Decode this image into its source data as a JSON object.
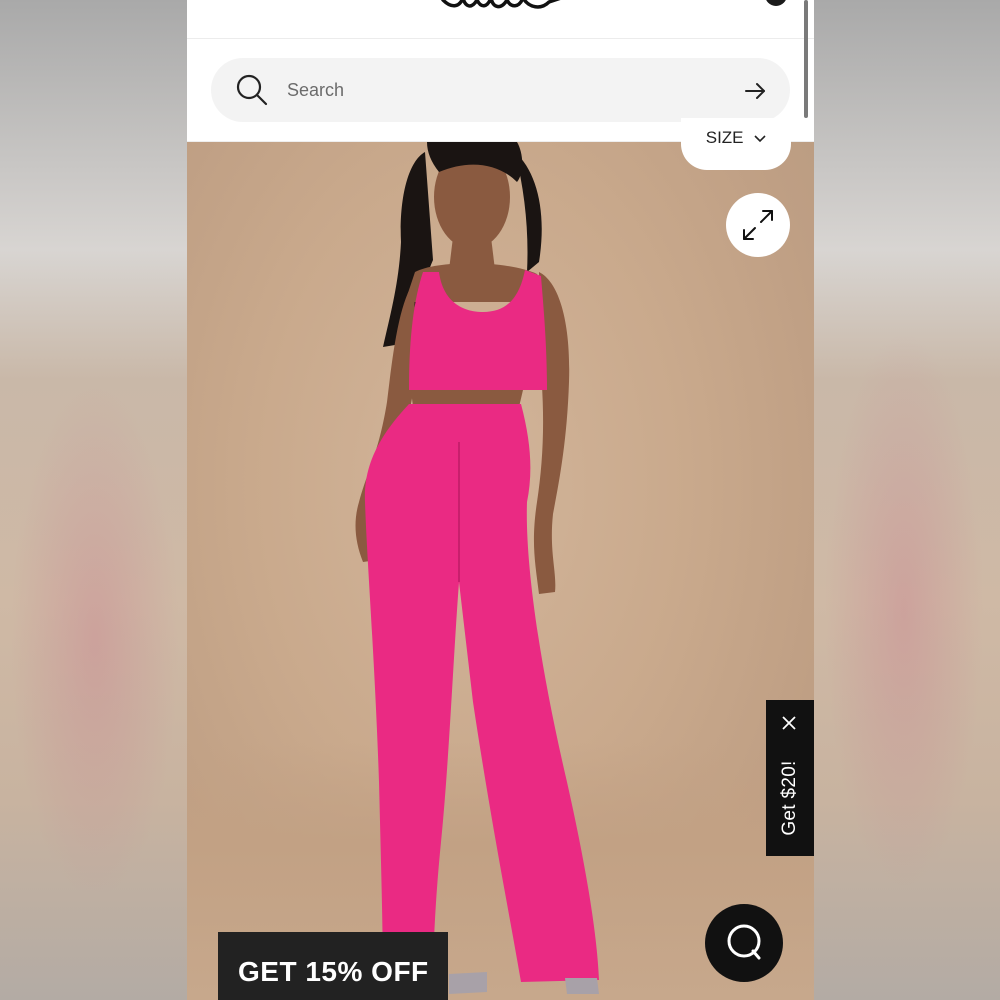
{
  "header": {
    "logo_text": "Lulus",
    "search": {
      "placeholder": "Search"
    }
  },
  "product": {
    "size_selector_label": "SIZE",
    "expand_icon": "expand-arrows-icon"
  },
  "promo": {
    "side_tab_label": "Get $20!",
    "banner_label": "GET 15% OFF"
  },
  "colors": {
    "header_bg": "#ffffff",
    "search_bg": "#f3f3f3",
    "photo_bg": "#c9a98c",
    "outfit_pink": "#ea2a83",
    "promo_bg": "#111111"
  }
}
